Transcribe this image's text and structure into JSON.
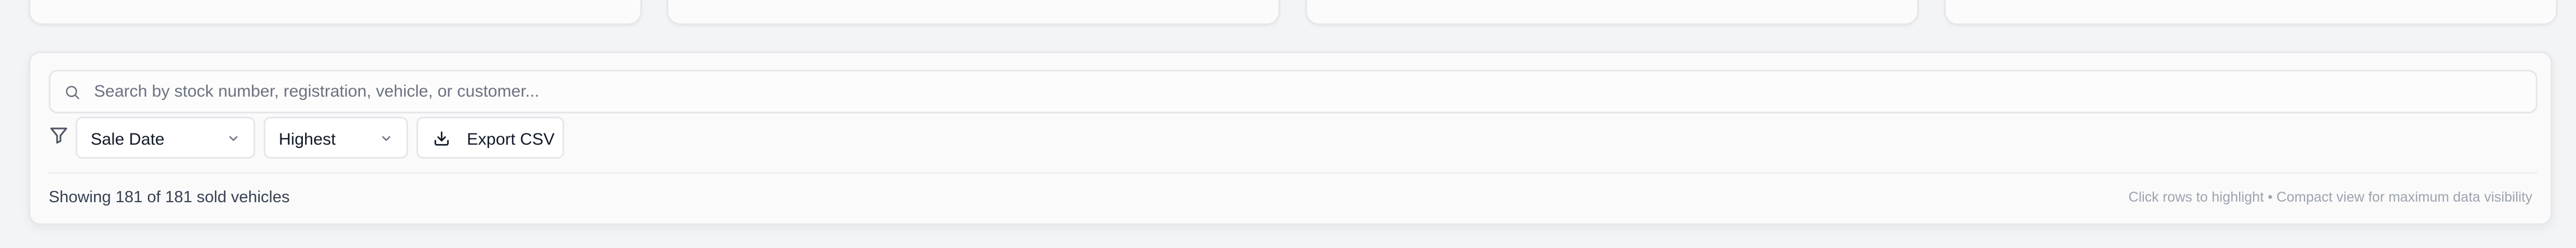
{
  "search": {
    "placeholder": "Search by stock number, registration, vehicle, or customer...",
    "value": ""
  },
  "filters": {
    "sort_field": "Sale Date",
    "sort_order": "Highest"
  },
  "toolbar": {
    "export_label": "Export CSV"
  },
  "footer": {
    "count_text": "Showing 181 of 181 sold vehicles",
    "hint_text": "Click rows to highlight • Compact view for maximum data visibility"
  },
  "icons": {
    "search": "search-icon",
    "filter": "filter-icon",
    "chevron": "chevron-down-icon",
    "download": "download-icon"
  }
}
